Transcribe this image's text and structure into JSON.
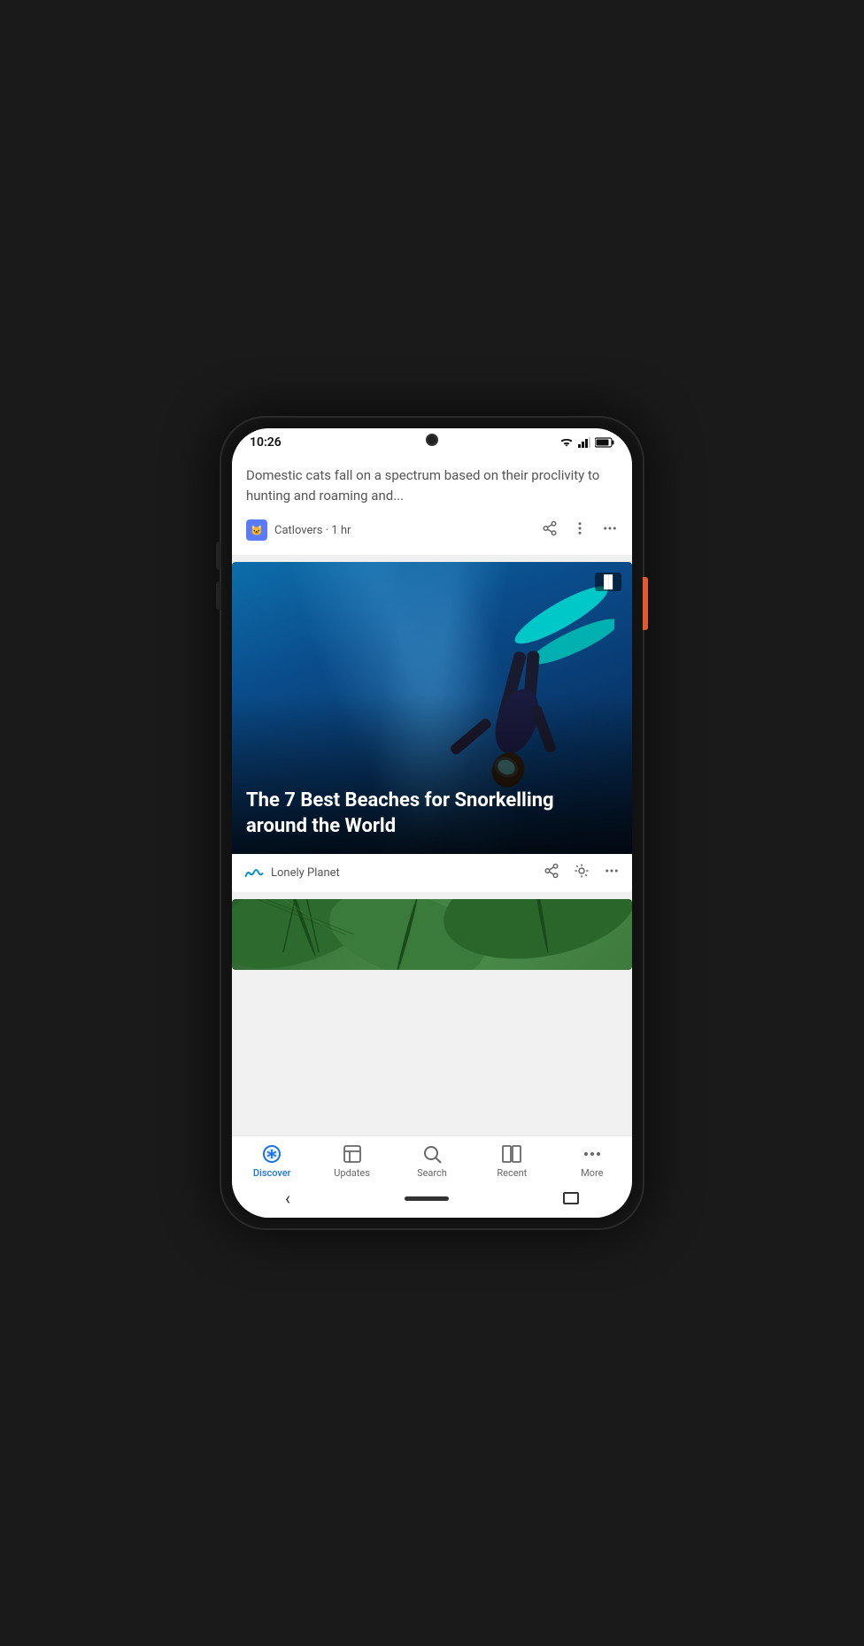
{
  "status_bar": {
    "time": "10:26"
  },
  "cards": [
    {
      "id": "cat-article",
      "type": "text",
      "text": "Domestic cats fall on a spectrum based on their proclivity to hunting and roaming and...",
      "source": "Catlovers",
      "time_ago": "1 hr"
    },
    {
      "id": "snorkeling-article",
      "type": "image",
      "title": "The 7 Best Beaches for Snorkelling around the World",
      "source": "Lonely Planet",
      "image_alt": "Snorkeler diving underwater with blue fins in deep blue ocean"
    },
    {
      "id": "partial-article",
      "type": "partial",
      "image_alt": "Green tropical leaves pattern"
    }
  ],
  "bottom_nav": {
    "items": [
      {
        "id": "discover",
        "label": "Discover",
        "icon": "✳",
        "active": true
      },
      {
        "id": "updates",
        "label": "Updates",
        "icon": "⊡",
        "active": false
      },
      {
        "id": "search",
        "label": "Search",
        "icon": "🔍",
        "active": false
      },
      {
        "id": "recent",
        "label": "Recent",
        "icon": "◫",
        "active": false
      },
      {
        "id": "more",
        "label": "More",
        "icon": "···",
        "active": false
      }
    ]
  },
  "android_nav": {
    "back_label": "‹"
  }
}
